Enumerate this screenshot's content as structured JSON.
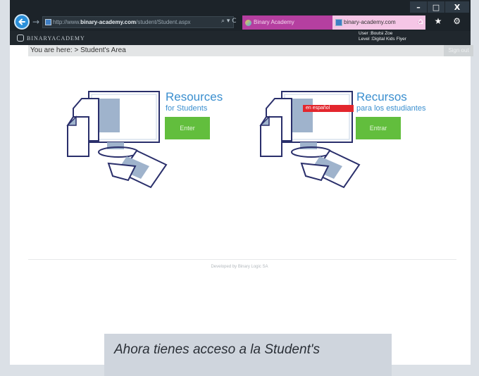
{
  "browser": {
    "address_prefix": "http://www.",
    "address_domain": "binary-academy.com",
    "address_path": "/student/Student.aspx",
    "address_icons": "⌕ ▾ C",
    "tab1_title": "Binary Academy",
    "tab2_title": "binary-academy.com",
    "tab2_close": "×",
    "window_buttons": [
      "–",
      "□",
      "X"
    ],
    "toolbar_icons": "⌂ ★ ⚙"
  },
  "site": {
    "logo_text": "BINARYACADEMY",
    "user_line": "User :Boutsi Zoe",
    "level_line": "Level :Digital Kids Flyer"
  },
  "page": {
    "breadcrumb": "You are here:  > Student's Area",
    "signout_label": "Sign out",
    "english_card": {
      "title": "Resources",
      "subtitle": "for Students",
      "button_label": "Enter"
    },
    "spanish_card": {
      "badge": "en español",
      "title": "Recursos",
      "subtitle": "para los estudiantes",
      "button_label": "Entrar"
    },
    "footer": "Developed by Binary Logic SA"
  },
  "caption": {
    "line1": "Ahora tienes acceso a la Student's"
  },
  "colors": {
    "accent_blue": "#3b8fcf",
    "button_green": "#62be3d",
    "badge_red": "#e3262d",
    "tab_magenta": "#b53fa0"
  }
}
